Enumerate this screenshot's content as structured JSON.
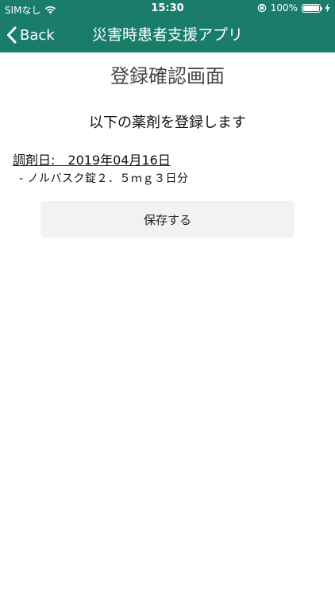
{
  "status_bar": {
    "carrier": "SIMなし",
    "time": "15:30",
    "battery_percent": "100%",
    "battery_level": 1.0
  },
  "nav": {
    "back_label": "Back",
    "title": "災害時患者支援アプリ"
  },
  "page": {
    "title": "登録確認画面",
    "subtitle": "以下の薬剤を登録します",
    "dispense_date": "調剤日:　2019年04月16日",
    "items": [
      "- ノルバスク錠２．５ｍｇ３日分"
    ],
    "save_label": "保存する"
  },
  "colors": {
    "header_bg": "#1a7d6c",
    "button_bg": "#f2f2f2"
  }
}
